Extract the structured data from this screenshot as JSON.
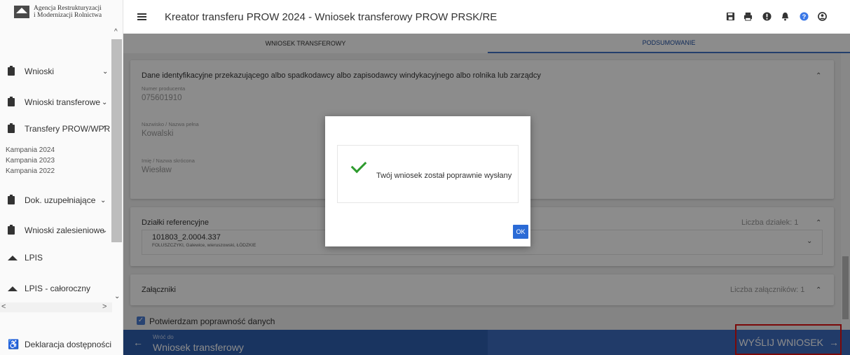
{
  "sidebar": {
    "logo_line1": "Agencja Restrukturyzacji",
    "logo_line2": "i Modernizacji Rolnictwa",
    "items": [
      {
        "label": "Wnioski"
      },
      {
        "label": "Wnioski transferowe"
      },
      {
        "label": "Transfery PROW/WPR"
      },
      {
        "label": "Dok. uzupełniające"
      },
      {
        "label": "Wnioski zalesieniowe"
      },
      {
        "label": "LPIS"
      },
      {
        "label": "LPIS - całoroczny"
      },
      {
        "label": "Deklaracja dostępności"
      }
    ],
    "campaigns": [
      "Kampania 2024",
      "Kampania 2023",
      "Kampania 2022"
    ]
  },
  "header": {
    "title": "Kreator transferu PROW 2024 - Wniosek transferowy PROW PRSK/RE"
  },
  "tabs": [
    {
      "label": "WNIOSEK TRANSFEROWY"
    },
    {
      "label": "PODSUMOWANIE"
    }
  ],
  "section_identity": {
    "title": "Dane identyfikacyjne przekazującego albo spadkodawcy albo zapisodawcy windykacyjnego albo rolnika lub zarządcy",
    "fields": [
      {
        "label": "Numer producenta",
        "value": "075601910"
      },
      {
        "label": "Nazwisko / Nazwa pełna",
        "value": "Kowalski"
      },
      {
        "label": "Imię / Nazwa skrócona",
        "value": "Wiesław"
      }
    ]
  },
  "section_parcels": {
    "title": "Działki referencyjne",
    "count": "Liczba działek: 1",
    "parcel_id": "101803_2.0004.337",
    "parcel_location": "FOLUSZCZYKI, Galewice, wieruszowski, ŁÓDZKIE"
  },
  "section_attachments": {
    "title": "Załączniki",
    "count": "Liczba załączników: 1"
  },
  "confirm": {
    "label": "Potwierdzam poprawność danych",
    "checked": true
  },
  "bottom": {
    "back_small": "Wróć do",
    "back_big": "Wniosek transferowy",
    "send_label": "WYŚLIJ WNIOSEK"
  },
  "modal": {
    "message": "Twój wniosek został poprawnie wysłany",
    "ok_label": "OK"
  },
  "colors": {
    "primary": "#2f5fb0",
    "accent": "#4173c5",
    "success": "#2e9b2e",
    "highlight": "#e01212"
  },
  "icons": [
    "menu-icon",
    "save-icon",
    "print-icon",
    "info-icon",
    "bell-icon",
    "help-icon",
    "user-icon"
  ]
}
